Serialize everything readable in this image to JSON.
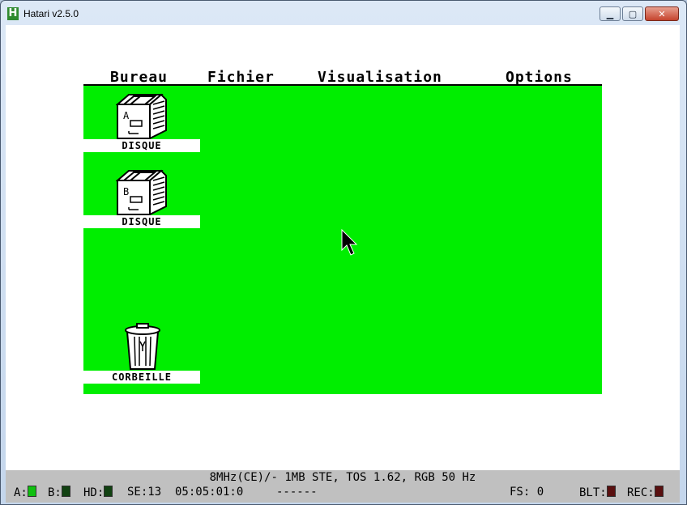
{
  "window": {
    "title": "Hatari v2.5.0",
    "app_icon_letter": "H",
    "minimize_glyph": "▁",
    "maximize_glyph": "▢",
    "close_glyph": "✕"
  },
  "menu": {
    "items": [
      "Bureau",
      "Fichier",
      "Visualisation",
      "Options"
    ]
  },
  "desktop": {
    "background_color": "#00ee00",
    "icons": [
      {
        "label": "DISQUE",
        "drive_letter": "A"
      },
      {
        "label": "DISQUE",
        "drive_letter": "B"
      },
      {
        "label": "CORBEILLE"
      }
    ]
  },
  "statusbar": {
    "machine_info": "8MHz(CE)/- 1MB STE, TOS 1.62, RGB 50 Hz",
    "drive_a": "A:",
    "drive_b": "B:",
    "hd": "HD:",
    "se": "SE:13",
    "time": "05:05:01:0",
    "dashes": "------",
    "fs": "FS: 0",
    "blt": "BLT:",
    "rec": "REC:"
  }
}
